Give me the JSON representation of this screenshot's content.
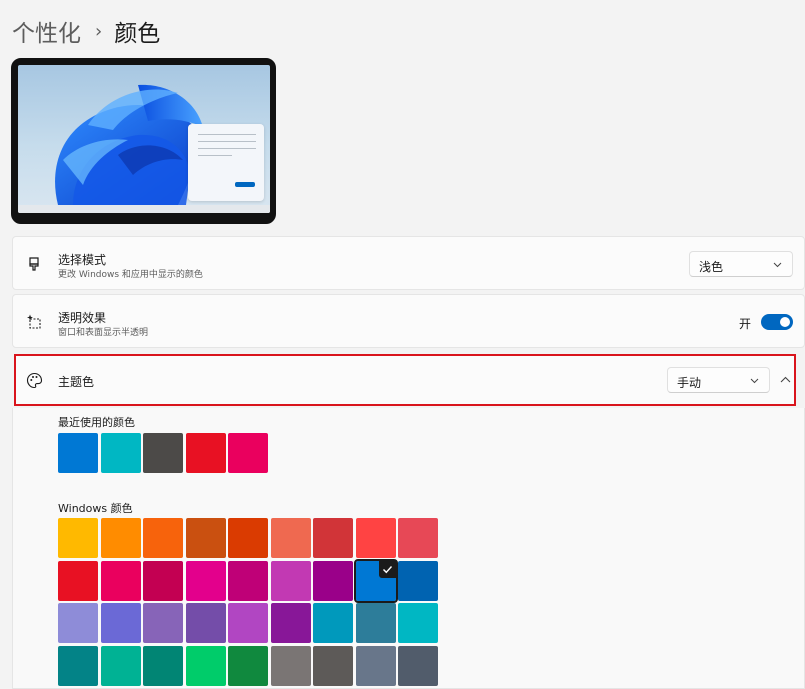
{
  "breadcrumb": {
    "parent": "个性化",
    "separator": "›",
    "current": "颜色"
  },
  "cards": {
    "mode": {
      "title": "选择模式",
      "subtitle": "更改 Windows 和应用中显示的颜色",
      "value": "浅色",
      "icon": "brush-icon"
    },
    "transparency": {
      "title": "透明效果",
      "subtitle": "窗口和表面显示半透明",
      "state_label": "开",
      "on": true,
      "icon": "transparency-icon"
    },
    "accent": {
      "title": "主题色",
      "value": "手动",
      "icon": "palette-icon",
      "expanded": true
    }
  },
  "recent_colors": {
    "label": "最近使用的颜色",
    "colors": [
      "#0078d4",
      "#00b7c3",
      "#4c4a48",
      "#e81123",
      "#ea005e"
    ]
  },
  "windows_colors": {
    "label": "Windows 颜色",
    "selected": "#0078d4",
    "rows": [
      [
        "#ffb900",
        "#ff8c00",
        "#f7630c",
        "#ca5010",
        "#da3b01",
        "#ef6950",
        "#d13438",
        "#ff4343",
        "#e74856"
      ],
      [
        "#e81123",
        "#ea005e",
        "#c30052",
        "#e3008c",
        "#bf0077",
        "#c239b3",
        "#9a0089",
        "#0078d4",
        "#0063b1"
      ],
      [
        "#8e8cd8",
        "#6b69d6",
        "#8764b8",
        "#744da9",
        "#b146c2",
        "#881798",
        "#0099bc",
        "#2d7d9a",
        "#00b7c3"
      ],
      [
        "#038387",
        "#00b294",
        "#018574",
        "#00cc6a",
        "#10893e",
        "#7a7574",
        "#5d5a58",
        "#68768a",
        "#515c6b"
      ]
    ]
  }
}
